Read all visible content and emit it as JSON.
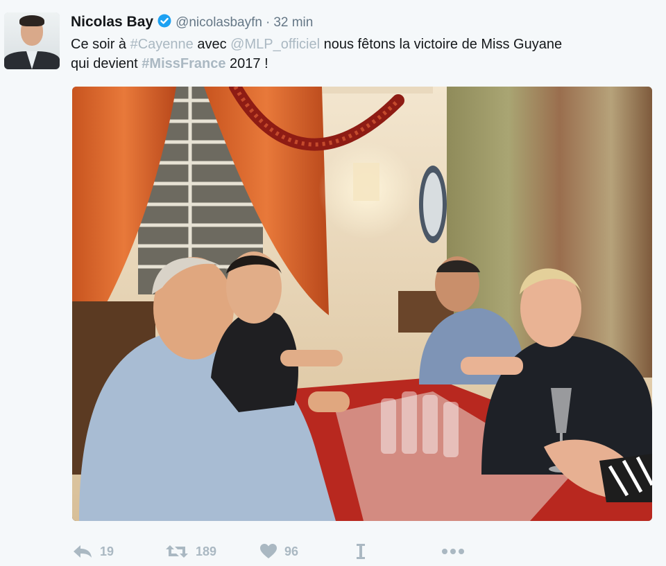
{
  "tweet": {
    "author": {
      "name": "Nicolas Bay",
      "handle": "@nicolasbayfn",
      "separator": "·",
      "time": "32 min"
    },
    "text": {
      "l1_a": "Ce soir à ",
      "l1_hashtag": "#Cayenne",
      "l1_b": " avec ",
      "l1_mention": "@MLP_officiel",
      "l1_c": " nous fêtons la victoire de Miss Guyane",
      "l2_a": "qui devient ",
      "l2_hashtag": "#MissFrance",
      "l2_b": " 2017 !"
    },
    "actions": {
      "reply_count": "19",
      "retweet_count": "189",
      "like_count": "96"
    }
  },
  "colors": {
    "link": "#aab8c2",
    "verified": "#1da1f2",
    "action_icon": "#aab8c2"
  }
}
